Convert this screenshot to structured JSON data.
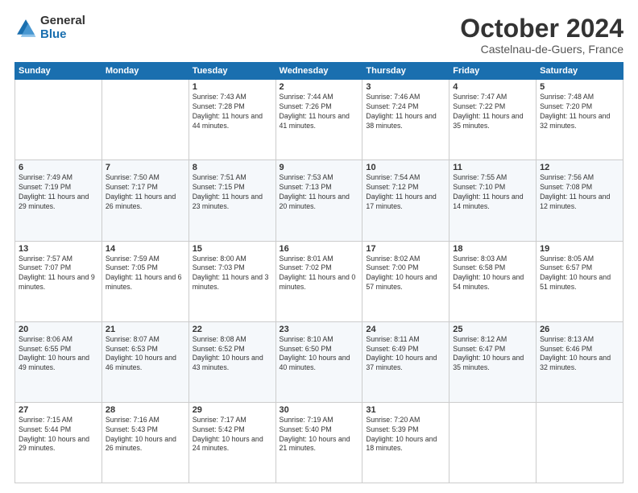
{
  "logo": {
    "general": "General",
    "blue": "Blue"
  },
  "header": {
    "month": "October 2024",
    "location": "Castelnau-de-Guers, France"
  },
  "weekdays": [
    "Sunday",
    "Monday",
    "Tuesday",
    "Wednesday",
    "Thursday",
    "Friday",
    "Saturday"
  ],
  "weeks": [
    [
      {
        "day": "",
        "sunrise": "",
        "sunset": "",
        "daylight": ""
      },
      {
        "day": "",
        "sunrise": "",
        "sunset": "",
        "daylight": ""
      },
      {
        "day": "1",
        "sunrise": "Sunrise: 7:43 AM",
        "sunset": "Sunset: 7:28 PM",
        "daylight": "Daylight: 11 hours and 44 minutes."
      },
      {
        "day": "2",
        "sunrise": "Sunrise: 7:44 AM",
        "sunset": "Sunset: 7:26 PM",
        "daylight": "Daylight: 11 hours and 41 minutes."
      },
      {
        "day": "3",
        "sunrise": "Sunrise: 7:46 AM",
        "sunset": "Sunset: 7:24 PM",
        "daylight": "Daylight: 11 hours and 38 minutes."
      },
      {
        "day": "4",
        "sunrise": "Sunrise: 7:47 AM",
        "sunset": "Sunset: 7:22 PM",
        "daylight": "Daylight: 11 hours and 35 minutes."
      },
      {
        "day": "5",
        "sunrise": "Sunrise: 7:48 AM",
        "sunset": "Sunset: 7:20 PM",
        "daylight": "Daylight: 11 hours and 32 minutes."
      }
    ],
    [
      {
        "day": "6",
        "sunrise": "Sunrise: 7:49 AM",
        "sunset": "Sunset: 7:19 PM",
        "daylight": "Daylight: 11 hours and 29 minutes."
      },
      {
        "day": "7",
        "sunrise": "Sunrise: 7:50 AM",
        "sunset": "Sunset: 7:17 PM",
        "daylight": "Daylight: 11 hours and 26 minutes."
      },
      {
        "day": "8",
        "sunrise": "Sunrise: 7:51 AM",
        "sunset": "Sunset: 7:15 PM",
        "daylight": "Daylight: 11 hours and 23 minutes."
      },
      {
        "day": "9",
        "sunrise": "Sunrise: 7:53 AM",
        "sunset": "Sunset: 7:13 PM",
        "daylight": "Daylight: 11 hours and 20 minutes."
      },
      {
        "day": "10",
        "sunrise": "Sunrise: 7:54 AM",
        "sunset": "Sunset: 7:12 PM",
        "daylight": "Daylight: 11 hours and 17 minutes."
      },
      {
        "day": "11",
        "sunrise": "Sunrise: 7:55 AM",
        "sunset": "Sunset: 7:10 PM",
        "daylight": "Daylight: 11 hours and 14 minutes."
      },
      {
        "day": "12",
        "sunrise": "Sunrise: 7:56 AM",
        "sunset": "Sunset: 7:08 PM",
        "daylight": "Daylight: 11 hours and 12 minutes."
      }
    ],
    [
      {
        "day": "13",
        "sunrise": "Sunrise: 7:57 AM",
        "sunset": "Sunset: 7:07 PM",
        "daylight": "Daylight: 11 hours and 9 minutes."
      },
      {
        "day": "14",
        "sunrise": "Sunrise: 7:59 AM",
        "sunset": "Sunset: 7:05 PM",
        "daylight": "Daylight: 11 hours and 6 minutes."
      },
      {
        "day": "15",
        "sunrise": "Sunrise: 8:00 AM",
        "sunset": "Sunset: 7:03 PM",
        "daylight": "Daylight: 11 hours and 3 minutes."
      },
      {
        "day": "16",
        "sunrise": "Sunrise: 8:01 AM",
        "sunset": "Sunset: 7:02 PM",
        "daylight": "Daylight: 11 hours and 0 minutes."
      },
      {
        "day": "17",
        "sunrise": "Sunrise: 8:02 AM",
        "sunset": "Sunset: 7:00 PM",
        "daylight": "Daylight: 10 hours and 57 minutes."
      },
      {
        "day": "18",
        "sunrise": "Sunrise: 8:03 AM",
        "sunset": "Sunset: 6:58 PM",
        "daylight": "Daylight: 10 hours and 54 minutes."
      },
      {
        "day": "19",
        "sunrise": "Sunrise: 8:05 AM",
        "sunset": "Sunset: 6:57 PM",
        "daylight": "Daylight: 10 hours and 51 minutes."
      }
    ],
    [
      {
        "day": "20",
        "sunrise": "Sunrise: 8:06 AM",
        "sunset": "Sunset: 6:55 PM",
        "daylight": "Daylight: 10 hours and 49 minutes."
      },
      {
        "day": "21",
        "sunrise": "Sunrise: 8:07 AM",
        "sunset": "Sunset: 6:53 PM",
        "daylight": "Daylight: 10 hours and 46 minutes."
      },
      {
        "day": "22",
        "sunrise": "Sunrise: 8:08 AM",
        "sunset": "Sunset: 6:52 PM",
        "daylight": "Daylight: 10 hours and 43 minutes."
      },
      {
        "day": "23",
        "sunrise": "Sunrise: 8:10 AM",
        "sunset": "Sunset: 6:50 PM",
        "daylight": "Daylight: 10 hours and 40 minutes."
      },
      {
        "day": "24",
        "sunrise": "Sunrise: 8:11 AM",
        "sunset": "Sunset: 6:49 PM",
        "daylight": "Daylight: 10 hours and 37 minutes."
      },
      {
        "day": "25",
        "sunrise": "Sunrise: 8:12 AM",
        "sunset": "Sunset: 6:47 PM",
        "daylight": "Daylight: 10 hours and 35 minutes."
      },
      {
        "day": "26",
        "sunrise": "Sunrise: 8:13 AM",
        "sunset": "Sunset: 6:46 PM",
        "daylight": "Daylight: 10 hours and 32 minutes."
      }
    ],
    [
      {
        "day": "27",
        "sunrise": "Sunrise: 7:15 AM",
        "sunset": "Sunset: 5:44 PM",
        "daylight": "Daylight: 10 hours and 29 minutes."
      },
      {
        "day": "28",
        "sunrise": "Sunrise: 7:16 AM",
        "sunset": "Sunset: 5:43 PM",
        "daylight": "Daylight: 10 hours and 26 minutes."
      },
      {
        "day": "29",
        "sunrise": "Sunrise: 7:17 AM",
        "sunset": "Sunset: 5:42 PM",
        "daylight": "Daylight: 10 hours and 24 minutes."
      },
      {
        "day": "30",
        "sunrise": "Sunrise: 7:19 AM",
        "sunset": "Sunset: 5:40 PM",
        "daylight": "Daylight: 10 hours and 21 minutes."
      },
      {
        "day": "31",
        "sunrise": "Sunrise: 7:20 AM",
        "sunset": "Sunset: 5:39 PM",
        "daylight": "Daylight: 10 hours and 18 minutes."
      },
      {
        "day": "",
        "sunrise": "",
        "sunset": "",
        "daylight": ""
      },
      {
        "day": "",
        "sunrise": "",
        "sunset": "",
        "daylight": ""
      }
    ]
  ]
}
